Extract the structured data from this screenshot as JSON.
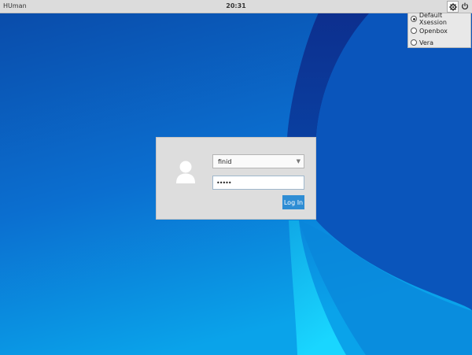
{
  "topbar": {
    "hostname": "HUman",
    "clock": "20:31"
  },
  "icons": {
    "settings": "gear-icon",
    "power": "power-icon",
    "avatar": "user-avatar-icon",
    "dropdown": "chevron-down-icon"
  },
  "session_menu": {
    "items": [
      {
        "label": "Default Xsession",
        "checked": true
      },
      {
        "label": "Openbox",
        "checked": false
      },
      {
        "label": "Vera",
        "checked": false
      }
    ]
  },
  "login": {
    "username": "finid",
    "password_value": "•••••",
    "login_label": "Log In"
  },
  "colors": {
    "accent": "#2f8dd4",
    "desktop_dark": "#0b3d9c",
    "desktop_light": "#15b2f0"
  }
}
